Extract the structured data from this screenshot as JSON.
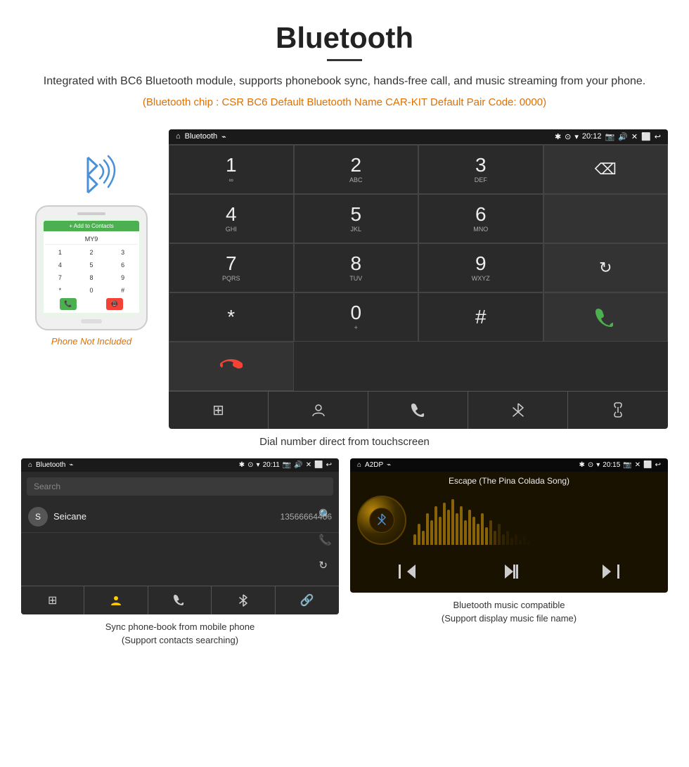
{
  "header": {
    "title": "Bluetooth",
    "divider": true,
    "description": "Integrated with BC6 Bluetooth module, supports phonebook sync, hands-free call, and music streaming from your phone.",
    "specs": "(Bluetooth chip : CSR BC6    Default Bluetooth Name CAR-KIT    Default Pair Code: 0000)"
  },
  "phone_label": "Phone Not Included",
  "dialpad_screen": {
    "statusbar": {
      "title": "Bluetooth",
      "time": "20:12",
      "usb_icon": "⌁",
      "bt_icon": "✱",
      "location_icon": "⊙",
      "signal_icon": "▾"
    },
    "keys": [
      {
        "num": "1",
        "letters": "∞"
      },
      {
        "num": "2",
        "letters": "ABC"
      },
      {
        "num": "3",
        "letters": "DEF"
      },
      {
        "num": "",
        "letters": "",
        "special": "backspace"
      },
      {
        "num": "4",
        "letters": "GHI"
      },
      {
        "num": "5",
        "letters": "JKL"
      },
      {
        "num": "6",
        "letters": "MNO"
      },
      {
        "num": "",
        "letters": "",
        "special": "empty"
      },
      {
        "num": "7",
        "letters": "PQRS"
      },
      {
        "num": "8",
        "letters": "TUV"
      },
      {
        "num": "9",
        "letters": "WXYZ"
      },
      {
        "num": "",
        "letters": "",
        "special": "refresh"
      },
      {
        "num": "*",
        "letters": ""
      },
      {
        "num": "0",
        "letters": "+"
      },
      {
        "num": "#",
        "letters": ""
      },
      {
        "num": "",
        "letters": "",
        "special": "green-call"
      },
      {
        "num": "",
        "letters": "",
        "special": "red-call"
      }
    ],
    "bottom_bar": [
      "⊞",
      "👤",
      "☎",
      "✱",
      "🔗"
    ]
  },
  "main_caption": "Dial number direct from touchscreen",
  "contacts_screen": {
    "statusbar_title": "Bluetooth",
    "time": "20:11",
    "search_placeholder": "Search",
    "contacts": [
      {
        "initial": "S",
        "name": "Seicane",
        "number": "13566664466"
      }
    ],
    "bottom_caption": "Sync phone-book from mobile phone\n(Support contacts searching)"
  },
  "music_screen": {
    "statusbar_title": "A2DP",
    "time": "20:15",
    "song_title": "Escape (The Pina Colada Song)",
    "bottom_caption": "Bluetooth music compatible\n(Support display music file name)"
  }
}
